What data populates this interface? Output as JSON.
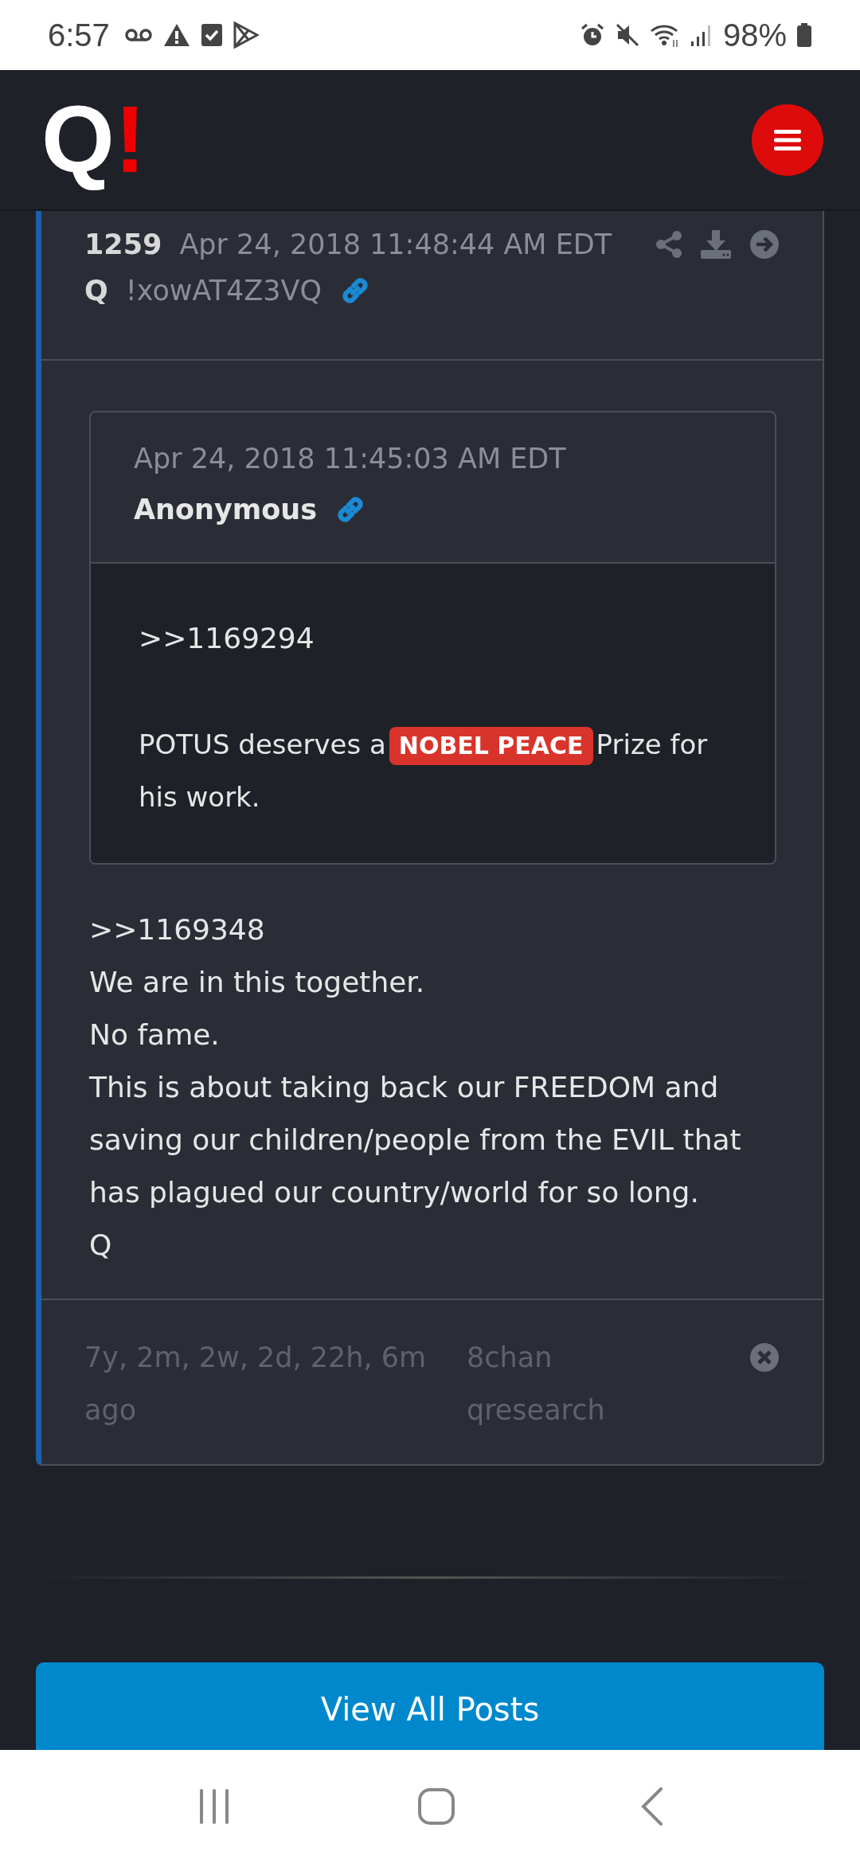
{
  "status_bar": {
    "time": "6:57",
    "battery": "98%"
  },
  "header": {
    "logo_letter": "Q",
    "logo_mark": "!"
  },
  "post": {
    "number": "1259",
    "date": "Apr 24, 2018 11:48:44 AM EDT",
    "author": "Q",
    "tripcode": "!xowAT4Z3VQ",
    "quote": {
      "date": "Apr 24, 2018 11:45:03 AM EDT",
      "author": "Anonymous",
      "reference": ">>1169294",
      "segments": [
        {
          "kind": "text",
          "text": "POTUS deserves a"
        },
        {
          "kind": "badge",
          "text": "NOBEL PEACE"
        },
        {
          "kind": "text",
          "text": "Prize for"
        },
        {
          "kind": "text",
          "text": "his work."
        }
      ]
    },
    "lines": [
      ">>1169348",
      "We are in this together.",
      "No fame.",
      "This is about taking back our FREEDOM and saving our children/people from the EVIL that has plagued our country/world for so long.",
      "Q"
    ],
    "age": "7y, 2m, 2w, 2d, 22h, 6m ago",
    "source": "8chan qresearch"
  },
  "button": "View All Posts"
}
